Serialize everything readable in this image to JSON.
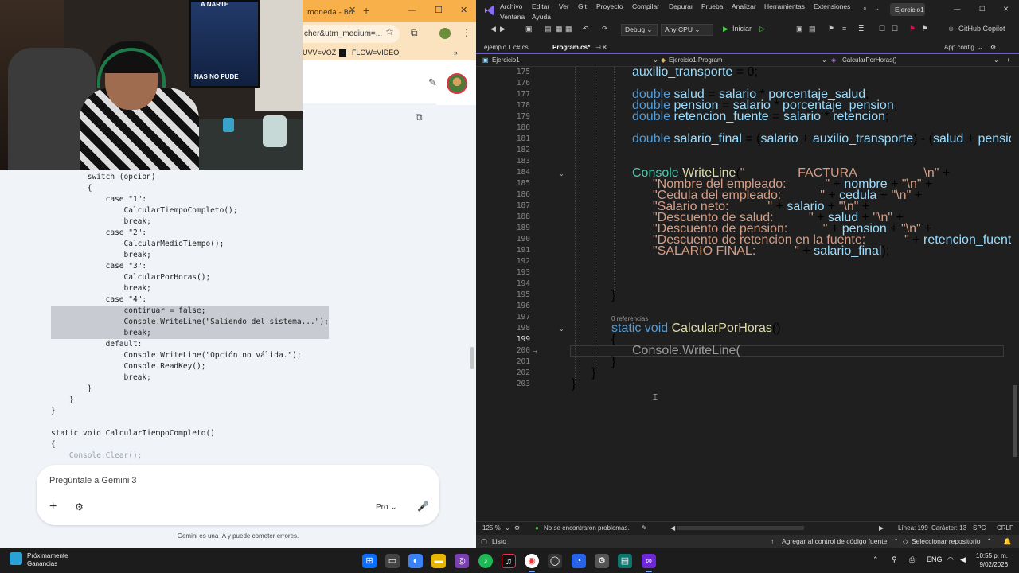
{
  "browser": {
    "tab_title": "moneda - Bu",
    "new_tab": "+",
    "address": "cher&utm_medium=...",
    "bookmarks": [
      "UVV=VOZ",
      "FLOW=VIDEO"
    ],
    "win_controls": [
      "—",
      "☐",
      "✕"
    ]
  },
  "webcam": {
    "poster_top": "A NARTE",
    "poster_bottom": "NAS NO PUDE"
  },
  "gemini": {
    "code_lines": [
      {
        "text": "        switch (opcion)",
        "hl": false
      },
      {
        "text": "        {",
        "hl": false
      },
      {
        "text": "            case \"1\":",
        "hl": false
      },
      {
        "text": "                CalcularTiempoCompleto();",
        "hl": false
      },
      {
        "text": "                break;",
        "hl": false
      },
      {
        "text": "            case \"2\":",
        "hl": false
      },
      {
        "text": "                CalcularMedioTiempo();",
        "hl": false
      },
      {
        "text": "                break;",
        "hl": false
      },
      {
        "text": "            case \"3\":",
        "hl": false
      },
      {
        "text": "                CalcularPorHoras();",
        "hl": false
      },
      {
        "text": "                break;",
        "hl": false
      },
      {
        "text": "            case \"4\":",
        "hl": false
      },
      {
        "text": "                continuar = false;",
        "hl": true
      },
      {
        "text": "                Console.WriteLine(\"Saliendo del sistema...\");",
        "hl": true
      },
      {
        "text": "                break;",
        "hl": true
      },
      {
        "text": "            default:",
        "hl": false
      },
      {
        "text": "                Console.WriteLine(\"Opción no válida.\");",
        "hl": false
      },
      {
        "text": "                Console.ReadKey();",
        "hl": false
      },
      {
        "text": "                break;",
        "hl": false
      },
      {
        "text": "        }",
        "hl": false
      },
      {
        "text": "    }",
        "hl": false
      },
      {
        "text": "}",
        "hl": false
      },
      {
        "text": "",
        "hl": false
      },
      {
        "text": "static void CalcularTiempoCompleto()",
        "hl": false
      },
      {
        "text": "{",
        "hl": false
      },
      {
        "text": "    Console.Clear();",
        "hl": false
      }
    ],
    "input_placeholder": "Pregúntale a Gemini 3",
    "model": "Pro",
    "disclaimer": "Gemini es una IA y puede cometer errores."
  },
  "vs": {
    "menu": [
      "Archivo",
      "Editar",
      "Ver",
      "Git",
      "Proyecto",
      "Compilar",
      "Depurar",
      "Prueba",
      "Analizar",
      "Herramientas",
      "Extensiones"
    ],
    "menu_row2": [
      "Ventana",
      "Ayuda"
    ],
    "solution_name": "Ejercicio1",
    "config": "Debug",
    "platform": "Any CPU",
    "start_label": "Iniciar",
    "copilot_label": "GitHub Copilot",
    "tabs": [
      {
        "label": "ejemplo 1 c#.cs",
        "active": false
      },
      {
        "label": "Program.cs*",
        "active": true
      }
    ],
    "right_tab": "App.config",
    "nav": {
      "project": "Ejercicio1",
      "class": "Ejercicio1.Program",
      "member": "CalcularPorHoras()"
    },
    "line_numbers": [
      "175",
      "176",
      "177",
      "178",
      "179",
      "180",
      "181",
      "182",
      "183",
      "184",
      "185",
      "186",
      "187",
      "188",
      "189",
      "190",
      "191",
      "192",
      "193",
      "194",
      "195",
      "196",
      "197",
      "198",
      "199",
      "200",
      "201",
      "202",
      "203"
    ],
    "code_ref_hint": "0 referencias",
    "zoom": "125 %",
    "status_problems": "No se encontraron problemas.",
    "line": "Línea: 199",
    "char": "Carácter: 13",
    "spc": "SPC",
    "crlf": "CRLF",
    "ready": "Listo",
    "add_to_source": "Agregar al control de código fuente",
    "select_repo": "Seleccionar repositorio"
  },
  "taskbar": {
    "weather_title": "Próximamente",
    "weather_sub": "Ganancias",
    "lang": "ENG",
    "time": "10:55 p. m.",
    "date": "9/02/2026"
  }
}
